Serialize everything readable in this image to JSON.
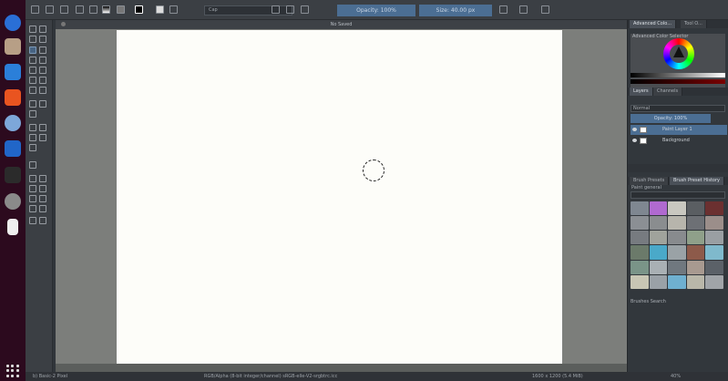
{
  "toolbar": {
    "blend_mode": "Cap",
    "opacity": "Opacity: 100%",
    "size": "Size: 40.00 px"
  },
  "document": {
    "tab_title": "No Saved"
  },
  "dockers": {
    "color_tab": "Advanced Colo...",
    "tool_tab": "Tool O...",
    "color_selector_title": "Advanced Color Selector",
    "layers_tab": "Layers",
    "channels_tab": "Channels",
    "blend_mode": "Normal",
    "layer_opacity": "Opacity: 100%",
    "layers": [
      {
        "name": "Paint Layer 1",
        "selected": true
      },
      {
        "name": "Background",
        "selected": false
      }
    ],
    "brush_tab": "Brush Presets",
    "history_tab": "Brush Preset History",
    "tag_label": "Paint general",
    "search_label": "Brushes Search"
  },
  "statusbar": {
    "left": "b) Basic-2 Pixel",
    "mid": "RGB/Alpha (8-bit integer/channel) sRGB-elle-V2-srgbtrc.icc",
    "right": "1600 x 1200 (5.4 MiB)",
    "zoom": "40%"
  },
  "colors": {
    "accent": "#4b6e93",
    "canvas_bg": "#7c7e7b",
    "panel_bg": "#32373c"
  }
}
